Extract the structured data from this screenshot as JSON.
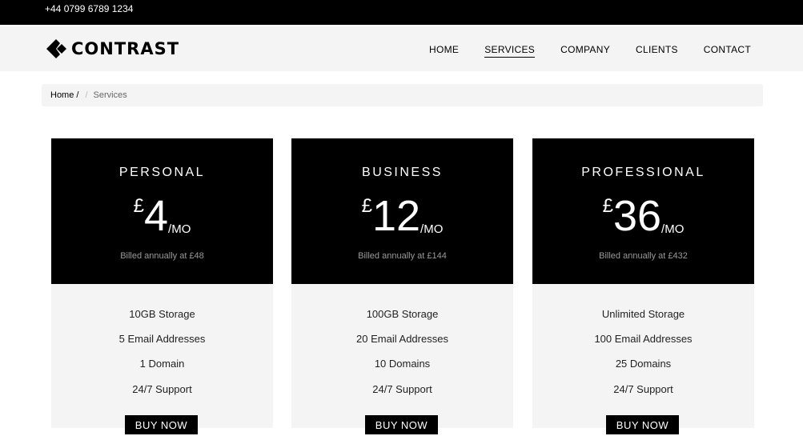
{
  "topbar": {
    "phone": "+44 0799 6789 1234"
  },
  "brand": {
    "name": "CONTRAST"
  },
  "nav": {
    "items": [
      {
        "label": "HOME"
      },
      {
        "label": "SERVICES"
      },
      {
        "label": "COMPANY"
      },
      {
        "label": "CLIENTS"
      },
      {
        "label": "CONTACT"
      }
    ],
    "active": "SERVICES"
  },
  "breadcrumb": {
    "home": "Home /",
    "sep": "/",
    "current": "Services"
  },
  "plans": [
    {
      "name": "PERSONAL",
      "currency": "£",
      "amount": "4",
      "period": "/MO",
      "billed": "Billed annually at £48",
      "features": [
        "10GB Storage",
        "5 Email Addresses",
        "1 Domain",
        "24/7 Support"
      ],
      "cta": "BUY NOW"
    },
    {
      "name": "BUSINESS",
      "currency": "£",
      "amount": "12",
      "period": "/MO",
      "billed": "Billed annually at £144",
      "features": [
        "100GB Storage",
        "20 Email Addresses",
        "10 Domains",
        "24/7 Support"
      ],
      "cta": "BUY NOW"
    },
    {
      "name": "PROFESSIONAL",
      "currency": "£",
      "amount": "36",
      "period": "/MO",
      "billed": "Billed annually at £432",
      "features": [
        "Unlimited Storage",
        "100 Email Addresses",
        "25 Domains",
        "24/7 Support"
      ],
      "cta": "BUY NOW"
    }
  ],
  "colors": {
    "dark": "#000000",
    "panel": "#f4f4f4",
    "muted": "#9a9a9a"
  }
}
